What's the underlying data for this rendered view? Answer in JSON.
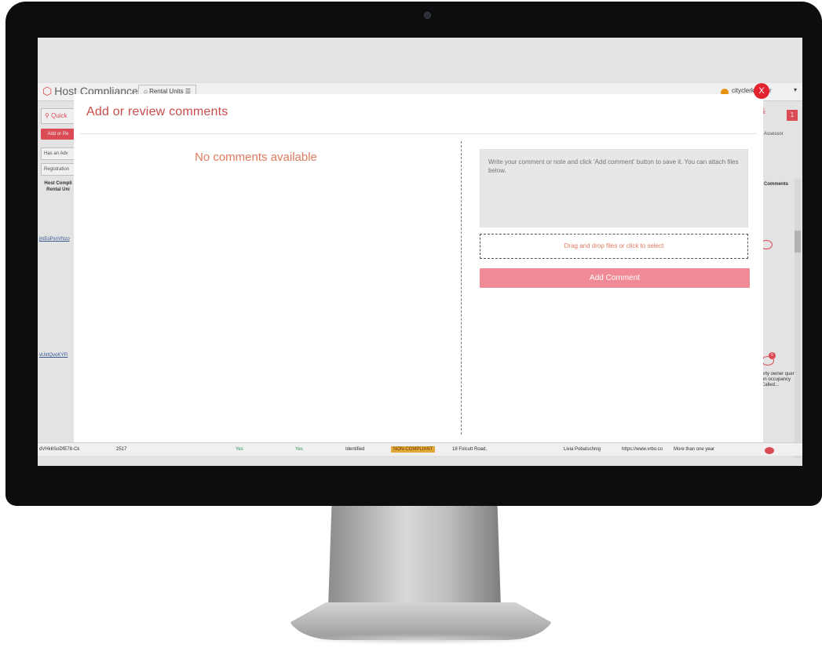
{
  "app": {
    "logo_text": "Host Compliance",
    "nav_tab": "Rental Units",
    "user_name": "cityclerkspider",
    "quick_search_placeholder": "Quick",
    "add_button_label": "Add or Re",
    "filter_1": "Has an Adv",
    "filter_2": "Registration",
    "column_header": "Host Compli Rental Uni",
    "row_link_1": "jmEoPxnVNzo",
    "row_link_2": "vUlrtQvoKYFi",
    "right_panel_header": "Assessor",
    "comments_header": "Comments",
    "notification_count": "1",
    "side_comment_count": "6",
    "side_comment_note": "erty owner quent on occupancy Called..."
  },
  "table_row": {
    "id": "dVHk6SoDfE78-Ck",
    "number": "2517",
    "col_yes_1": "Yes",
    "col_yes_2": "Yes",
    "status": "Identified",
    "compliance": "NON-COMPLIANT",
    "address": "18 Folcutt Road,",
    "owner": "Livia Pobatschnig",
    "url": "https://www.vrbo.co",
    "duration": "More than one year"
  },
  "modal": {
    "title": "Add or review comments",
    "empty_message": "No comments available",
    "comment_placeholder": "Write your comment or note and click 'Add comment' button to save it. You can attach files below.",
    "dropzone_label": "Drag and drop files or click to select",
    "add_comment_label": "Add Comment",
    "close_label": "X"
  },
  "colors": {
    "accent": "#e8505b",
    "title_text": "#c94b4b",
    "add_button_bg": "#f08a96",
    "non_compliant_badge": "#f0b43c",
    "close_button": "#e2232f"
  }
}
